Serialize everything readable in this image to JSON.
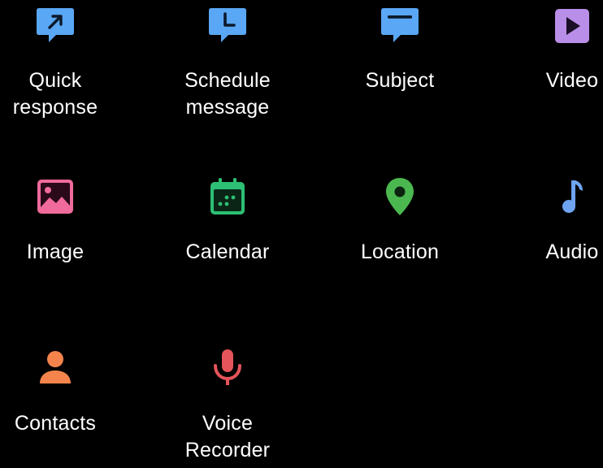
{
  "colors": {
    "background": "#000000",
    "text": "#ffffff",
    "blue": "#5aa7f5",
    "purple": "#b98ee8",
    "pink": "#f06a9b",
    "green": "#2dbf74",
    "location_green": "#4ab84f",
    "audio_blue": "#6ea3f0",
    "orange": "#f4844b",
    "red": "#e4545a"
  },
  "attachments": [
    {
      "label": "Quick\nresponse",
      "icon": "quick-response-icon"
    },
    {
      "label": "Schedule\nmessage",
      "icon": "schedule-message-icon"
    },
    {
      "label": "Subject",
      "icon": "subject-icon"
    },
    {
      "label": "Video",
      "icon": "video-icon"
    },
    {
      "label": "Image",
      "icon": "image-icon"
    },
    {
      "label": "Calendar",
      "icon": "calendar-icon"
    },
    {
      "label": "Location",
      "icon": "location-pin-icon"
    },
    {
      "label": "Audio",
      "icon": "music-note-icon"
    },
    {
      "label": "Contacts",
      "icon": "person-icon"
    },
    {
      "label": "Voice\nRecorder",
      "icon": "microphone-icon"
    }
  ]
}
